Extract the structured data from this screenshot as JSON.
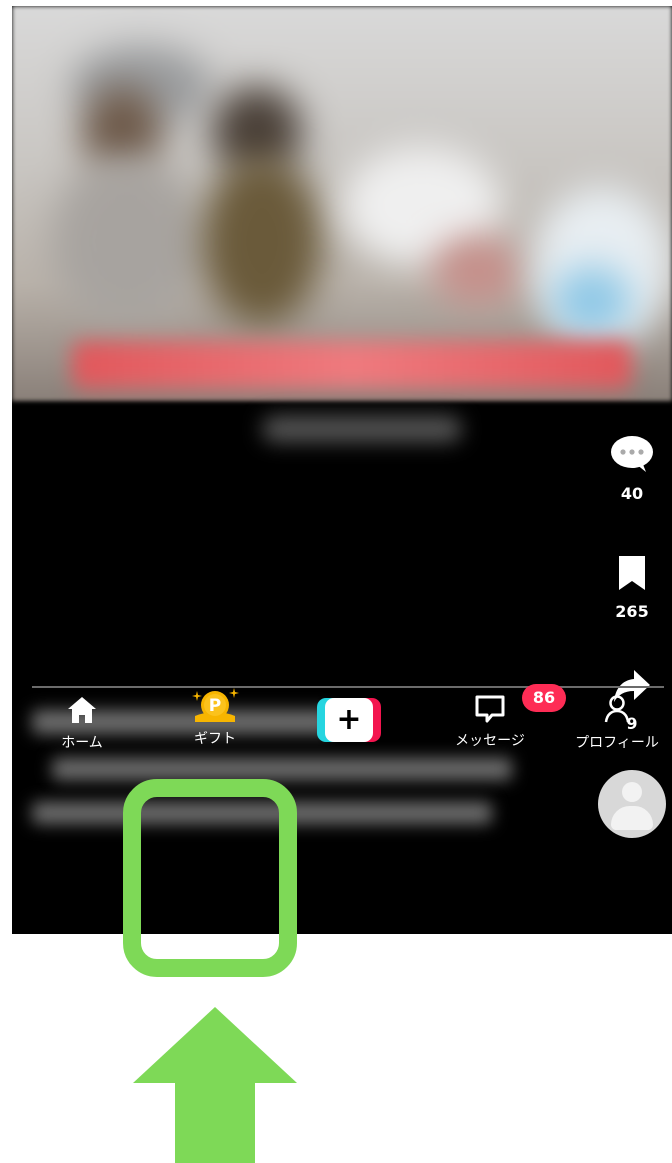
{
  "rail": {
    "comments": {
      "count": "40",
      "icon": "comment-icon"
    },
    "saves": {
      "count": "265",
      "icon": "bookmark-icon"
    },
    "shares": {
      "count": "9",
      "icon": "share-arrow-icon"
    },
    "profile": {
      "icon": "avatar-icon"
    }
  },
  "tabbar": {
    "home": {
      "label": "ホーム",
      "icon": "home-icon"
    },
    "gift": {
      "label": "ギフト",
      "icon": "gift-coin-icon",
      "coin_letter": "P"
    },
    "create": {
      "icon": "plus-icon",
      "symbol": "+"
    },
    "messages": {
      "label": "メッセージ",
      "icon": "message-icon",
      "badge": "86"
    },
    "profile": {
      "label": "プロフィール",
      "icon": "person-icon"
    }
  },
  "colors": {
    "highlight": "#7ed957",
    "badge": "#fe2c55",
    "coin": "#f7b500",
    "create_left": "#26d5e0",
    "create_right": "#f3154f"
  }
}
